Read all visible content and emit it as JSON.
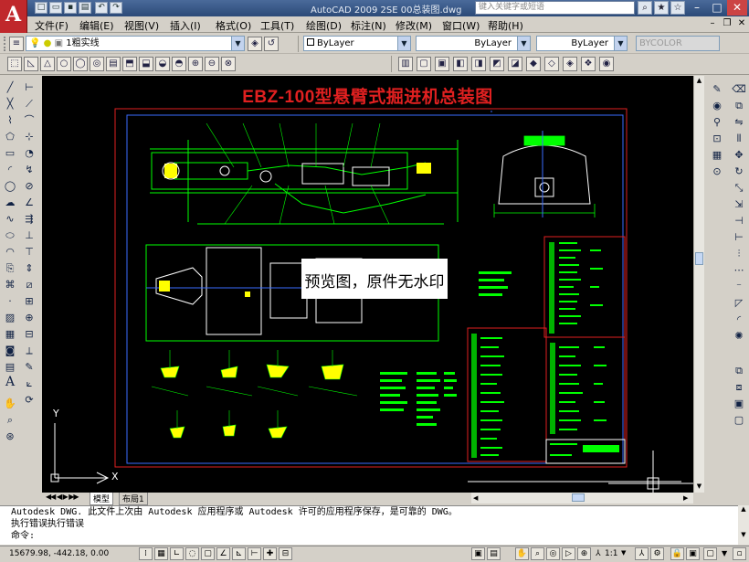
{
  "app": {
    "logo_letter": "A",
    "title": "AutoCAD 2009  2SE  00总装图.dwg",
    "search_placeholder": "键入关键字或短语"
  },
  "menu": [
    "文件(F)",
    "编辑(E)",
    "视图(V)",
    "插入(I)",
    "格式(O)",
    "工具(T)",
    "绘图(D)",
    "标注(N)",
    "修改(M)",
    "窗口(W)",
    "帮助(H)"
  ],
  "toolbar": {
    "layer_value": "1粗实线",
    "color_value": "ByLayer",
    "linetype_value": "ByLayer",
    "lineweight_value": "ByLayer",
    "plotstyle_value": "BYCOLOR"
  },
  "drawing": {
    "title": "EBZ-100型悬臂式掘进机总装图",
    "watermark": "预览图，原件无水印",
    "axis_x": "X",
    "axis_y": "Y",
    "colors": {
      "background": "#000000",
      "title": "#e02020",
      "frame": "#e02020",
      "inner_frame": "#3a6cff",
      "lines": "#00ff00",
      "parts": "#ffff00"
    }
  },
  "tabs": {
    "model": "模型",
    "layout1": "布局1"
  },
  "command": {
    "line1": "Autodesk DWG.   此文件上次由 Autodesk 应用程序或 Autodesk 许可的应用程序保存，是可靠的 DWG。",
    "line2": "执行错误执行错误",
    "prompt": "命令:"
  },
  "status": {
    "coordinates": "15679.98,  -442.18, 0.00",
    "scale": "1:1"
  }
}
